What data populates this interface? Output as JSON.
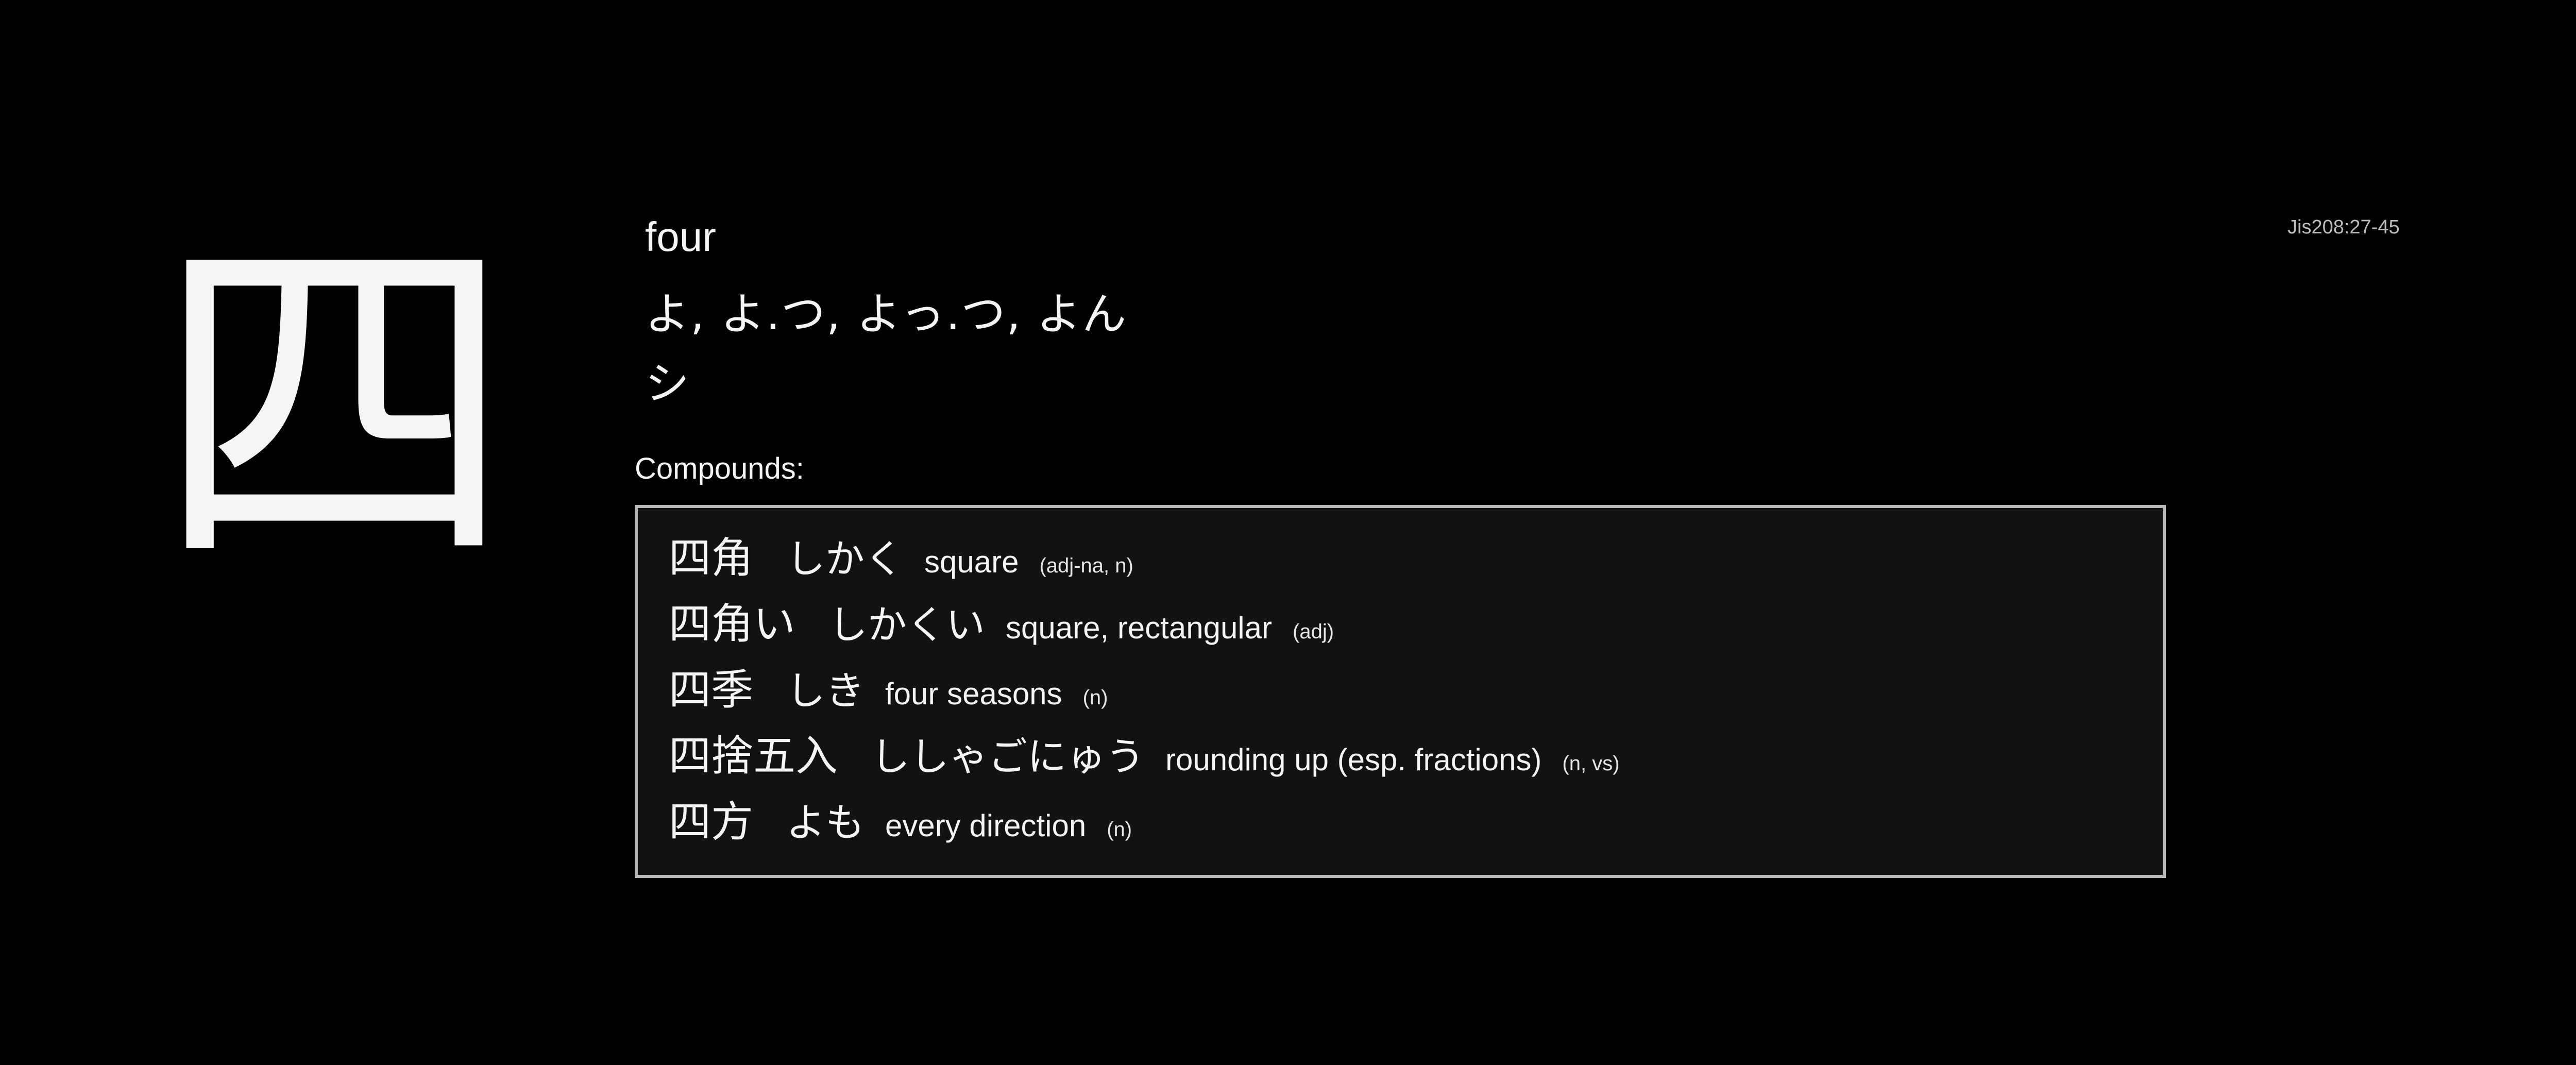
{
  "kanji": "四",
  "jis_code": "Jis208:27-45",
  "meaning": "four",
  "kun_readings": "よ, よ.つ, よっ.つ, よん",
  "on_readings": "シ",
  "compounds_label": "Compounds:",
  "compounds": [
    {
      "word": "四角",
      "reading": "しかく",
      "gloss": "square",
      "pos": "(adj-na, n)"
    },
    {
      "word": "四角い",
      "reading": "しかくい",
      "gloss": "square, rectangular",
      "pos": "(adj)"
    },
    {
      "word": "四季",
      "reading": "しき",
      "gloss": "four seasons",
      "pos": "(n)"
    },
    {
      "word": "四捨五入",
      "reading": "ししゃごにゅう",
      "gloss": "rounding up (esp. fractions)",
      "pos": "(n, vs)"
    },
    {
      "word": "四方",
      "reading": "よも",
      "gloss": "every direction",
      "pos": "(n)"
    }
  ],
  "colors": {
    "background": "#000000",
    "text": "#f5f5f5",
    "box_background": "#121212",
    "box_border": "#b8b8b8",
    "muted_text": "#bdbdbd"
  }
}
